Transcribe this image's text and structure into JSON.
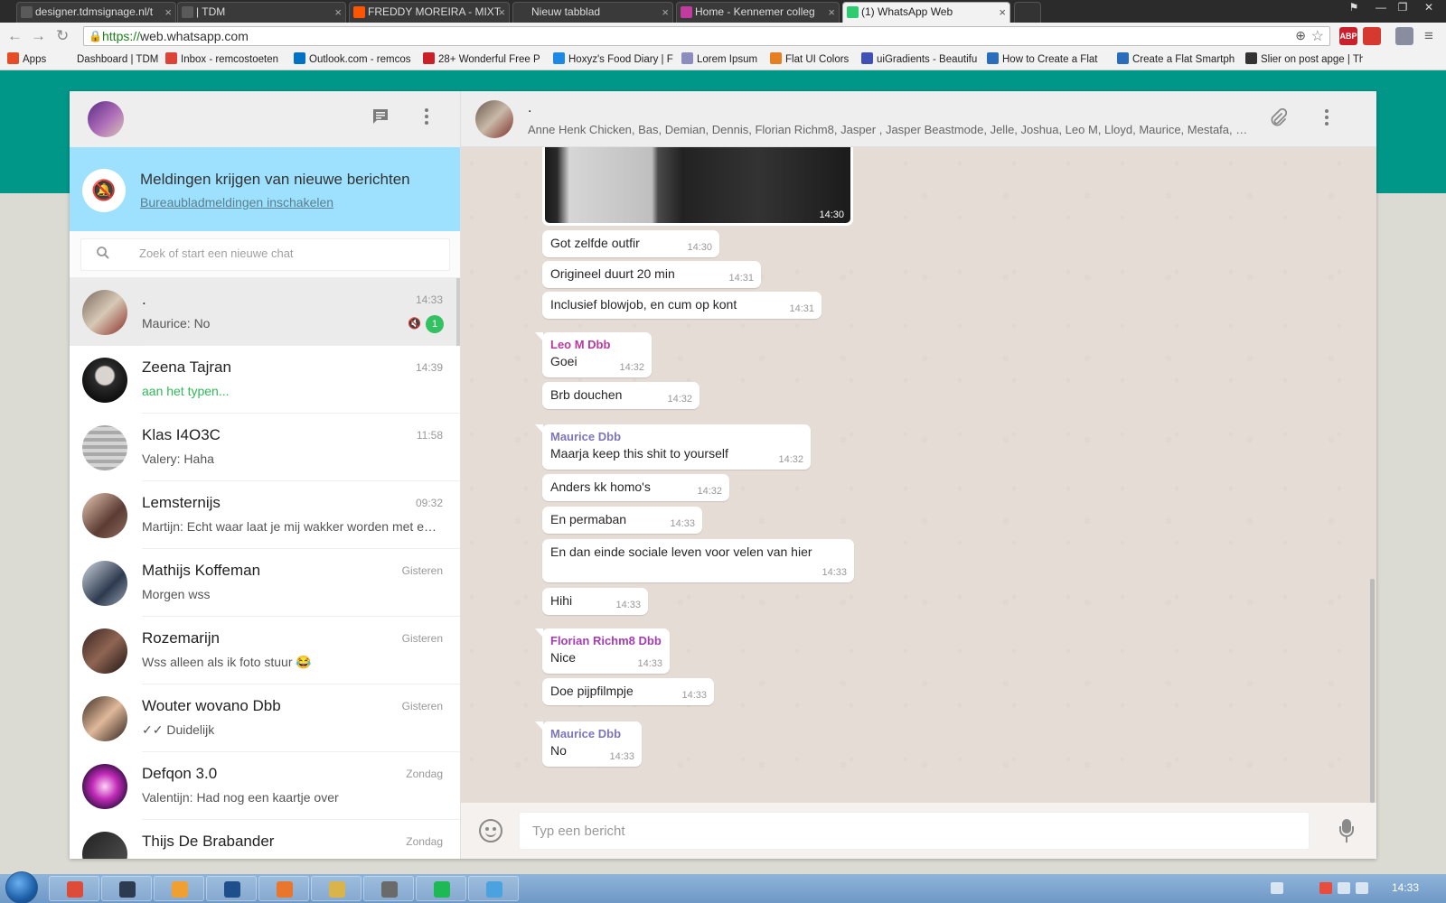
{
  "browser": {
    "tabs": [
      {
        "label": "designer.tdmsignage.nl/t",
        "active": false,
        "fav": "#5a5a5a"
      },
      {
        "label": "| TDM",
        "active": false,
        "fav": "#5a5a5a"
      },
      {
        "label": "FREDDY MOREIRA - MIXT",
        "active": false,
        "fav": "#ff5500"
      },
      {
        "label": "Nieuw tabblad",
        "active": false,
        "fav": ""
      },
      {
        "label": "Home - Kennemer colleg",
        "active": false,
        "fav": "#c23b9e"
      },
      {
        "label": "(1) WhatsApp Web",
        "active": true,
        "fav": "#2ecc71"
      }
    ],
    "url_scheme": "https://",
    "url_host": "web.whatsapp.com",
    "extensions": [
      "ABP",
      "",
      ""
    ],
    "bookmarks": [
      {
        "label": "Apps",
        "color": "#e44d26"
      },
      {
        "label": "Dashboard | TDM",
        "color": ""
      },
      {
        "label": "Inbox - remcostoeten",
        "color": "#db4437"
      },
      {
        "label": "Outlook.com - remcos",
        "color": "#0072c6"
      },
      {
        "label": "28+ Wonderful Free P",
        "color": "#cb2027"
      },
      {
        "label": "Hoxyz's Food Diary | F",
        "color": "#1e88e5"
      },
      {
        "label": "Lorem Ipsum",
        "color": "#8c8cbf"
      },
      {
        "label": "Flat UI Colors",
        "color": "#e67e22"
      },
      {
        "label": "uiGradients - Beautifu",
        "color": "#3f51b5"
      },
      {
        "label": "How to Create a Flat",
        "color": "#2a6ebb"
      },
      {
        "label": "Create a Flat Smartph",
        "color": "#2a6ebb"
      },
      {
        "label": "Slier on post apge | Th",
        "color": "#333333"
      }
    ]
  },
  "whatsapp": {
    "notification": {
      "title": "Meldingen krijgen van nieuwe berichten",
      "link": "Bureaubladmeldingen inschakelen"
    },
    "search_placeholder": "Zoek of start een nieuwe chat",
    "chats": [
      {
        "name": ".",
        "time": "14:33",
        "preview": "Maurice: No",
        "muted": true,
        "unread": "1",
        "selected": true,
        "typing": false,
        "avatar": "linear-gradient(135deg,#7a6a5e,#d7c9b6 50%,#8a2e28)"
      },
      {
        "name": "Zeena Tajran",
        "time": "14:39",
        "preview": "aan het typen...",
        "muted": false,
        "unread": "",
        "selected": false,
        "typing": true,
        "avatar": "radial-gradient(circle at 50% 40%,#d9d4cf 25%,#2b2b2b 30%,#111 70%)"
      },
      {
        "name": "Klas I4O3C",
        "time": "11:58",
        "preview": "Valery: Haha",
        "muted": false,
        "unread": "",
        "selected": false,
        "typing": false,
        "avatar": "repeating-linear-gradient(0deg,#a9a9a9 0,#a9a9a9 4px,#d4d4d4 4px,#d4d4d4 8px)"
      },
      {
        "name": "Lemsternijs",
        "time": "09:32",
        "preview": "Martijn: Echt waar laat je mij wakker worden met een ...",
        "muted": false,
        "unread": "",
        "selected": false,
        "typing": false,
        "avatar": "linear-gradient(135deg,#e9c9b3,#5b3b33 60%,#8f6c5e)"
      },
      {
        "name": "Mathijs Koffeman",
        "time": "Gisteren",
        "preview": "Morgen wss",
        "muted": false,
        "unread": "",
        "selected": false,
        "typing": false,
        "avatar": "linear-gradient(135deg,#cfd6df,#2d3a4f 60%,#97a2b0)"
      },
      {
        "name": "Rozemarijn",
        "time": "Gisteren",
        "preview": "Wss alleen als ik foto stuur 😂",
        "muted": false,
        "unread": "",
        "selected": false,
        "typing": false,
        "avatar": "linear-gradient(135deg,#3a2420,#8f6553 50%,#1d1311)"
      },
      {
        "name": "Wouter wovano Dbb",
        "time": "Gisteren",
        "preview": "✓✓ Duidelijk",
        "muted": false,
        "unread": "",
        "selected": false,
        "typing": false,
        "avatar": "linear-gradient(135deg,#3b2b22,#e0b89a 50%,#2a1e18)"
      },
      {
        "name": "Defqon 3.0",
        "time": "Zondag",
        "preview": "Valentijn: Had nog een kaartje over",
        "muted": false,
        "unread": "",
        "selected": false,
        "typing": false,
        "avatar": "radial-gradient(circle at 50% 50%,#ffd3f5,#c02ab8 40%,#2a0d3a 80%)"
      },
      {
        "name": "Thijs De Brabander",
        "time": "Zondag",
        "preview": "",
        "muted": false,
        "unread": "",
        "selected": false,
        "typing": false,
        "avatar": "linear-gradient(135deg,#222,#555)"
      }
    ],
    "group": {
      "title": ".",
      "members": "Anne Henk Chicken, Bas, Demian, Dennis, Florian Richm8, Jasper , Jasper Beastmode, Jelle, Joshua, Leo M, Lloyd, Maurice, Mestafa, Mika, Niels, Rick, Sven, Thijs, Valentijn, Wouter"
    },
    "image_time": "14:30",
    "messages": [
      {
        "sender": "",
        "text": "Got zelfde outfir",
        "time": "14:30",
        "tail": false
      },
      {
        "sender": "",
        "text": "Origineel  duurt 20 min",
        "time": "14:31",
        "tail": false
      },
      {
        "sender": "",
        "text": "Inclusief blowjob, en cum op kont",
        "time": "14:31",
        "tail": false
      },
      {
        "sender": "Leo M Dbb",
        "sender_color": "#b8399e",
        "text": "Goei",
        "time": "14:32",
        "tail": true
      },
      {
        "sender": "",
        "text": "Brb douchen",
        "time": "14:32",
        "tail": false
      },
      {
        "sender": "Maurice Dbb",
        "sender_color": "#7e75b8",
        "text": "Maarja keep this shit to yourself",
        "time": "14:32",
        "tail": true
      },
      {
        "sender": "",
        "text": "Anders kk homo's",
        "time": "14:32",
        "tail": false
      },
      {
        "sender": "",
        "text": "En permaban",
        "time": "14:33",
        "tail": false
      },
      {
        "sender": "",
        "text": "En dan einde sociale  leven voor velen  van hier",
        "time": "14:33",
        "tail": false
      },
      {
        "sender": "",
        "text": "Hihi",
        "time": "14:33",
        "tail": false
      },
      {
        "sender": "Florian Richm8 Dbb",
        "sender_color": "#a63cb5",
        "text": "Nice",
        "time": "14:33",
        "tail": true
      },
      {
        "sender": "",
        "text": "Doe pijpfilmpje",
        "time": "14:33",
        "tail": false
      },
      {
        "sender": "Maurice Dbb",
        "sender_color": "#7e75b8",
        "text": "No",
        "time": "14:33",
        "tail": true
      }
    ],
    "input_placeholder": "Typ een bericht"
  },
  "taskbar": {
    "clock": "14:33",
    "apps": [
      "chrome",
      "batman",
      "sublime",
      "photoshop",
      "firefox",
      "explorer",
      "calculator",
      "spotify",
      "tweetdeck"
    ]
  }
}
